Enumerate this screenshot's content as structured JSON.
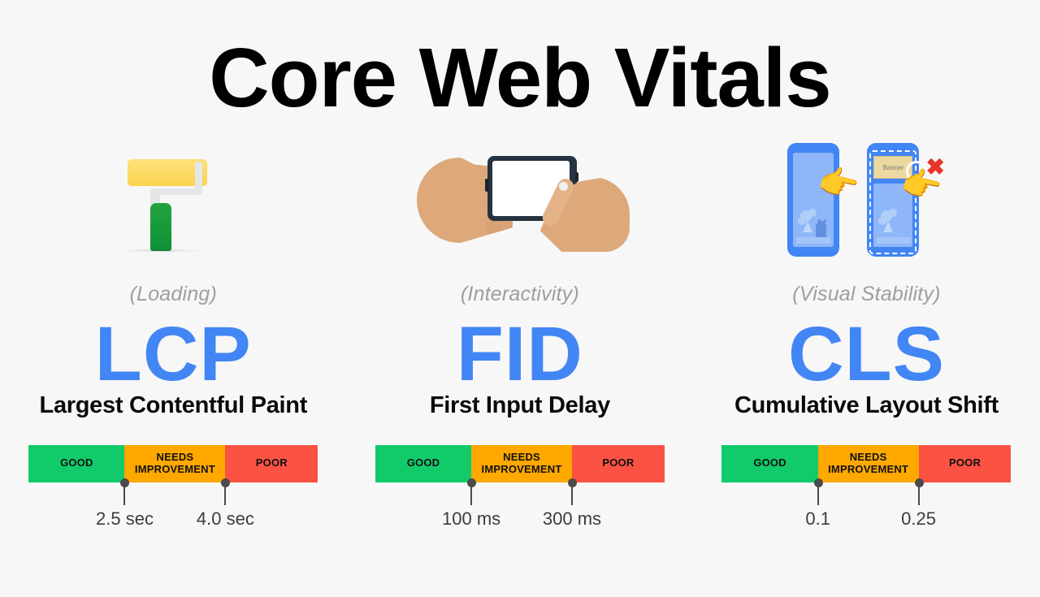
{
  "page": {
    "title": "Core Web Vitals",
    "background_color": "#f7f7f7",
    "accent_color": "#4285f4"
  },
  "legend": {
    "good_color": "#11cb6a",
    "needs_color": "#ffa800",
    "poor_color": "#fb5244",
    "marker_color": "#4a4a4a"
  },
  "metrics": [
    {
      "subtitle": "(Loading)",
      "acronym": "LCP",
      "fullname": "Largest Contentful Paint",
      "icon": "paint-roller-icon",
      "bar": {
        "good_label": "GOOD",
        "needs_label_line1": "NEEDS",
        "needs_label_line2": "IMPROVEMENT",
        "poor_label": "POOR"
      },
      "thresholds": [
        {
          "value": "2.5 sec",
          "position_pct": 33.2
        },
        {
          "value": "4.0 sec",
          "position_pct": 68.0
        }
      ]
    },
    {
      "subtitle": "(Interactivity)",
      "acronym": "FID",
      "fullname": "First Input Delay",
      "icon": "hand-tapping-phone-icon",
      "bar": {
        "good_label": "GOOD",
        "needs_label_line1": "NEEDS",
        "needs_label_line2": "IMPROVEMENT",
        "poor_label": "POOR"
      },
      "thresholds": [
        {
          "value": "100 ms",
          "position_pct": 33.2
        },
        {
          "value": "300 ms",
          "position_pct": 68.0
        }
      ]
    },
    {
      "subtitle": "(Visual Stability)",
      "acronym": "CLS",
      "fullname": "Cumulative Layout Shift",
      "icon": "layout-shift-phones-icon",
      "banner_label": "Banner",
      "bar": {
        "good_label": "GOOD",
        "needs_label_line1": "NEEDS",
        "needs_label_line2": "IMPROVEMENT",
        "poor_label": "POOR"
      },
      "thresholds": [
        {
          "value": "0.1",
          "position_pct": 33.2
        },
        {
          "value": "0.25",
          "position_pct": 68.0
        }
      ]
    }
  ]
}
